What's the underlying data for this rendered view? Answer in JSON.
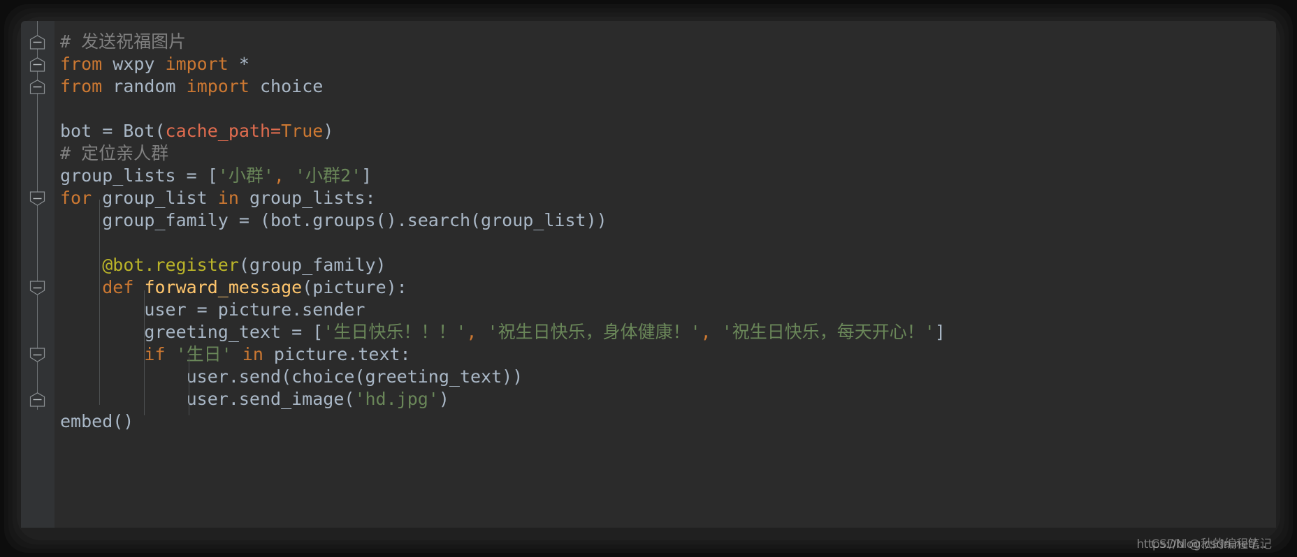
{
  "editor": {
    "theme_name": "darcula",
    "background": "#2b2b2b",
    "gutter_background": "#313335",
    "default_text_color": "#a9b7c6",
    "colors": {
      "keyword": "#cc7832",
      "string": "#6a8759",
      "comment": "#808080",
      "decorator": "#bbb529",
      "function_name": "#ffc66d",
      "keyword_argument": "#e06c4f",
      "number": "#6897bb"
    },
    "language": "python",
    "fold_icon": "fold-minus-icon"
  },
  "code": {
    "lines": [
      {
        "id": "line-1",
        "fold": "up",
        "tokens": [
          {
            "text": "# 发送祝福图片",
            "type": "com"
          }
        ]
      },
      {
        "id": "line-2",
        "fold": "both",
        "tokens": [
          {
            "text": "from",
            "type": "kw"
          },
          {
            "text": " wxpy ",
            "type": "def"
          },
          {
            "text": "import",
            "type": "kw"
          },
          {
            "text": " *",
            "type": "def"
          }
        ]
      },
      {
        "id": "line-3",
        "fold": "up",
        "tokens": [
          {
            "text": "from",
            "type": "kw"
          },
          {
            "text": " random ",
            "type": "def"
          },
          {
            "text": "import",
            "type": "kw"
          },
          {
            "text": " choice",
            "type": "def"
          }
        ]
      },
      {
        "id": "line-4",
        "fold": "",
        "tokens": []
      },
      {
        "id": "line-5",
        "fold": "",
        "tokens": [
          {
            "text": "bot = Bot(",
            "type": "def"
          },
          {
            "text": "cache_path",
            "type": "kwarg"
          },
          {
            "text": "=",
            "type": "kwarg"
          },
          {
            "text": "True",
            "type": "kw"
          },
          {
            "text": ")",
            "type": "def"
          }
        ]
      },
      {
        "id": "line-6",
        "fold": "",
        "tokens": [
          {
            "text": "# 定位亲人群",
            "type": "com"
          }
        ]
      },
      {
        "id": "line-7",
        "fold": "",
        "tokens": [
          {
            "text": "group_lists = [",
            "type": "def"
          },
          {
            "text": "'小群'",
            "type": "str"
          },
          {
            "text": ", ",
            "type": "kw"
          },
          {
            "text": "'小群2'",
            "type": "str"
          },
          {
            "text": "]",
            "type": "def"
          }
        ]
      },
      {
        "id": "line-8",
        "fold": "down",
        "tokens": [
          {
            "text": "for",
            "type": "kw"
          },
          {
            "text": " group_list ",
            "type": "def"
          },
          {
            "text": "in",
            "type": "kw"
          },
          {
            "text": " group_lists:",
            "type": "def"
          }
        ]
      },
      {
        "id": "line-9",
        "fold": "",
        "tokens": [
          {
            "text": "    group_family = (bot.groups().search(group_list))",
            "type": "def"
          }
        ]
      },
      {
        "id": "line-10",
        "fold": "",
        "tokens": []
      },
      {
        "id": "line-11",
        "fold": "",
        "tokens": [
          {
            "text": "    ",
            "type": "def"
          },
          {
            "text": "@bot.register",
            "type": "dec"
          },
          {
            "text": "(group_family)",
            "type": "def"
          }
        ]
      },
      {
        "id": "line-12",
        "fold": "down",
        "tokens": [
          {
            "text": "    ",
            "type": "def"
          },
          {
            "text": "def",
            "type": "kw"
          },
          {
            "text": " ",
            "type": "def"
          },
          {
            "text": "forward_message",
            "type": "fn"
          },
          {
            "text": "(picture):",
            "type": "def"
          }
        ]
      },
      {
        "id": "line-13",
        "fold": "",
        "tokens": [
          {
            "text": "        user = picture.sender",
            "type": "def"
          }
        ]
      },
      {
        "id": "line-14",
        "fold": "",
        "tokens": [
          {
            "text": "        greeting_text = [",
            "type": "def"
          },
          {
            "text": "'生日快乐！！！'",
            "type": "str"
          },
          {
            "text": ", ",
            "type": "kw"
          },
          {
            "text": "'祝生日快乐，身体健康！'",
            "type": "str"
          },
          {
            "text": ", ",
            "type": "kw"
          },
          {
            "text": "'祝生日快乐，每天开心！'",
            "type": "str"
          },
          {
            "text": "]",
            "type": "def"
          }
        ]
      },
      {
        "id": "line-15",
        "fold": "down",
        "tokens": [
          {
            "text": "        ",
            "type": "def"
          },
          {
            "text": "if",
            "type": "kw"
          },
          {
            "text": " ",
            "type": "def"
          },
          {
            "text": "'生日'",
            "type": "str"
          },
          {
            "text": " ",
            "type": "def"
          },
          {
            "text": "in",
            "type": "kw"
          },
          {
            "text": " picture.text:",
            "type": "def"
          }
        ]
      },
      {
        "id": "line-16",
        "fold": "",
        "tokens": [
          {
            "text": "            user.send(choice(greeting_text))",
            "type": "def"
          }
        ]
      },
      {
        "id": "line-17",
        "fold": "up",
        "tokens": [
          {
            "text": "            user.send_image(",
            "type": "def"
          },
          {
            "text": "'hd.jpg'",
            "type": "str"
          },
          {
            "text": ")",
            "type": "def"
          }
        ]
      },
      {
        "id": "line-18",
        "fold": "",
        "tokens": [
          {
            "text": "embed()",
            "type": "def"
          }
        ]
      }
    ]
  },
  "watermarks": {
    "url": "https://blog.csdn.net/...",
    "author": "CSDN @秋的编程笔记"
  }
}
